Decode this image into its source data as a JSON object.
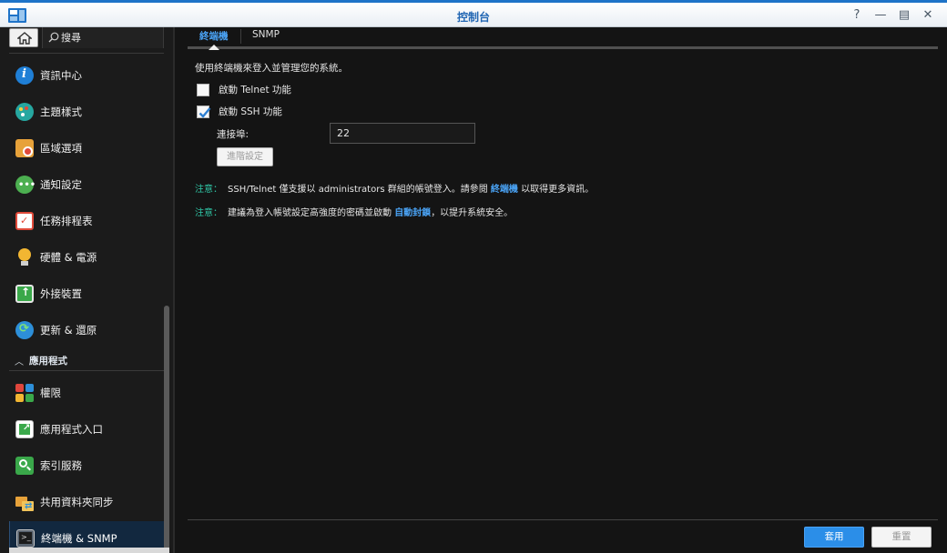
{
  "window": {
    "title": "控制台",
    "controls": [
      "help-icon",
      "minimize-icon",
      "restore-icon",
      "close-icon"
    ]
  },
  "sidebar": {
    "search_placeholder": "搜尋",
    "items": [
      {
        "label": "資訊中心",
        "icon": "info-icon",
        "color": "#1f7fd6"
      },
      {
        "label": "主題樣式",
        "icon": "palette-icon",
        "color": "#26a7a0"
      },
      {
        "label": "區域選項",
        "icon": "region-icon",
        "color": "#e7a23a"
      },
      {
        "label": "通知設定",
        "icon": "notification-icon",
        "color": "#4caf50"
      },
      {
        "label": "任務排程表",
        "icon": "calendar-icon",
        "color": "#e04a3a"
      },
      {
        "label": "硬體 & 電源",
        "icon": "bulb-icon",
        "color": "#f2b632"
      },
      {
        "label": "外接裝置",
        "icon": "upload-icon",
        "color": "#3aa84a"
      },
      {
        "label": "更新 & 還原",
        "icon": "update-icon",
        "color": "#2d8fd9"
      }
    ],
    "section_label": "應用程式",
    "app_items": [
      {
        "label": "權限",
        "icon": "permission-icon",
        "color": "#e0463c"
      },
      {
        "label": "應用程式入口",
        "icon": "app-portal-icon",
        "color": "#3aa84a"
      },
      {
        "label": "索引服務",
        "icon": "index-icon",
        "color": "#3aa84a"
      },
      {
        "label": "共用資料夾同步",
        "icon": "folder-sync-icon",
        "color": "#e7a23a"
      },
      {
        "label": "終端機 & SNMP",
        "icon": "terminal-icon",
        "color": "#5a6470"
      }
    ]
  },
  "tabs": [
    {
      "label": "終端機",
      "active": true
    },
    {
      "label": "SNMP",
      "active": false
    }
  ],
  "terminal": {
    "description": "使用終端機來登入並管理您的系統。",
    "telnet_label": "啟動 Telnet 功能",
    "telnet_checked": false,
    "ssh_label": "啟動 SSH 功能",
    "ssh_checked": true,
    "port_label": "連接埠:",
    "port_value": "22",
    "advanced_button": "進階設定",
    "note1": {
      "prefix": "注意：",
      "text_a": "SSH/Telnet 僅支援以 administrators 群組的帳號登入。請參閱",
      "link": "終端機",
      "text_b": "以取得更多資訊。"
    },
    "note2": {
      "prefix": "注意：",
      "text_a": "建議為登入帳號設定高強度的密碼並啟動",
      "link": "自動封鎖",
      "text_b": "，以提升系統安全。"
    }
  },
  "footer": {
    "apply_button": "套用",
    "reset_button": "重置"
  },
  "colors": {
    "accent": "#2b8ee8",
    "link": "#4aa3f5",
    "note_prefix": "#2fc6a6",
    "background": "#141414"
  }
}
